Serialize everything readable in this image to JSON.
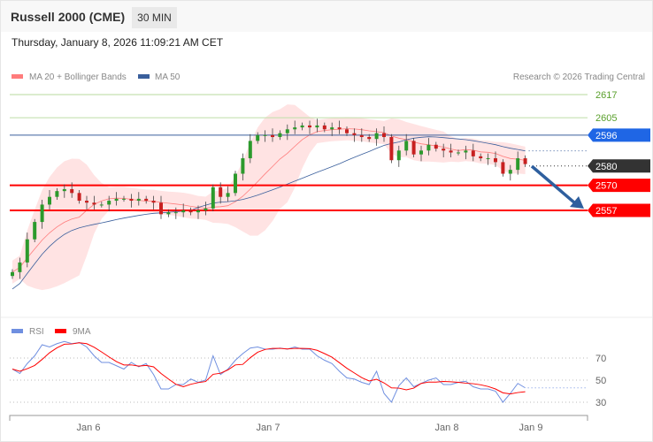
{
  "header": {
    "title": "Russell 2000 (CME)",
    "interval": "30 MIN",
    "timestamp": "Thursday, January 8, 2026 11:09:21 AM CET"
  },
  "legend": {
    "ma20": "MA 20 + Bollinger Bands",
    "ma50": "MA 50",
    "copyright": "Research © 2026 Trading Central",
    "rsi": "RSI",
    "rsi_ma": "9MA"
  },
  "colors": {
    "ma20": "#ff7c7c",
    "ma50": "#3a5f9c",
    "resistance_green": "#5aa02c",
    "pivot_blue": "#1f66e5",
    "current": "#333333",
    "support_red": "#ff0000",
    "arrow": "#2e5f9e",
    "rsi": "#6f8fe0",
    "rsi_ma": "#ff0000"
  },
  "levels": [
    {
      "label": "2617",
      "value": 2617,
      "kind": "resistance"
    },
    {
      "label": "2605",
      "value": 2605,
      "kind": "resistance"
    },
    {
      "label": "2596",
      "value": 2596,
      "kind": "pivot"
    },
    {
      "label": "2580",
      "value": 2580,
      "kind": "last"
    },
    {
      "label": "2570",
      "value": 2570,
      "kind": "support"
    },
    {
      "label": "2557",
      "value": 2557,
      "kind": "support"
    }
  ],
  "chart_data": [
    {
      "type": "candlestick",
      "title": "Russell 2000 (CME) 30 MIN",
      "ylim": [
        2515,
        2625
      ],
      "x_ticks": [
        "Jan 6",
        "Jan 7",
        "Jan 8",
        "Jan 9"
      ],
      "close": [
        2525,
        2530,
        2542,
        2551,
        2560,
        2564,
        2567,
        2568,
        2566,
        2562,
        2561,
        2560,
        2560,
        2562,
        2563,
        2563,
        2562,
        2563,
        2562,
        2561,
        2555,
        2556,
        2556,
        2557,
        2556,
        2557,
        2558,
        2569,
        2564,
        2566,
        2576,
        2584,
        2593,
        2596,
        2596,
        2595,
        2597,
        2599,
        2600,
        2601,
        2600,
        2601,
        2599,
        2600,
        2599,
        2597,
        2596,
        2595,
        2594,
        2597,
        2595,
        2583,
        2588,
        2593,
        2586,
        2588,
        2591,
        2589,
        2588,
        2587,
        2587,
        2588,
        2585,
        2584,
        2584,
        2582,
        2576,
        2578,
        2584,
        2581
      ],
      "forecast": {
        "direction": "down",
        "target": 2557
      }
    },
    {
      "type": "line",
      "title": "RSI",
      "ylim": [
        20,
        95
      ],
      "y_ticks": [
        "70",
        "50",
        "30"
      ],
      "rsi": [
        60,
        56,
        65,
        72,
        82,
        80,
        83,
        85,
        83,
        84,
        80,
        72,
        66,
        66,
        63,
        60,
        66,
        62,
        65,
        55,
        42,
        42,
        46,
        46,
        51,
        48,
        50,
        72,
        55,
        60,
        68,
        74,
        79,
        80,
        78,
        78,
        79,
        78,
        80,
        78,
        78,
        72,
        68,
        65,
        58,
        52,
        51,
        48,
        46,
        58,
        38,
        30,
        45,
        52,
        44,
        47,
        50,
        52,
        46,
        46,
        48,
        49,
        44,
        42,
        42,
        40,
        30,
        38,
        47,
        43
      ],
      "ma_period": 9
    }
  ]
}
